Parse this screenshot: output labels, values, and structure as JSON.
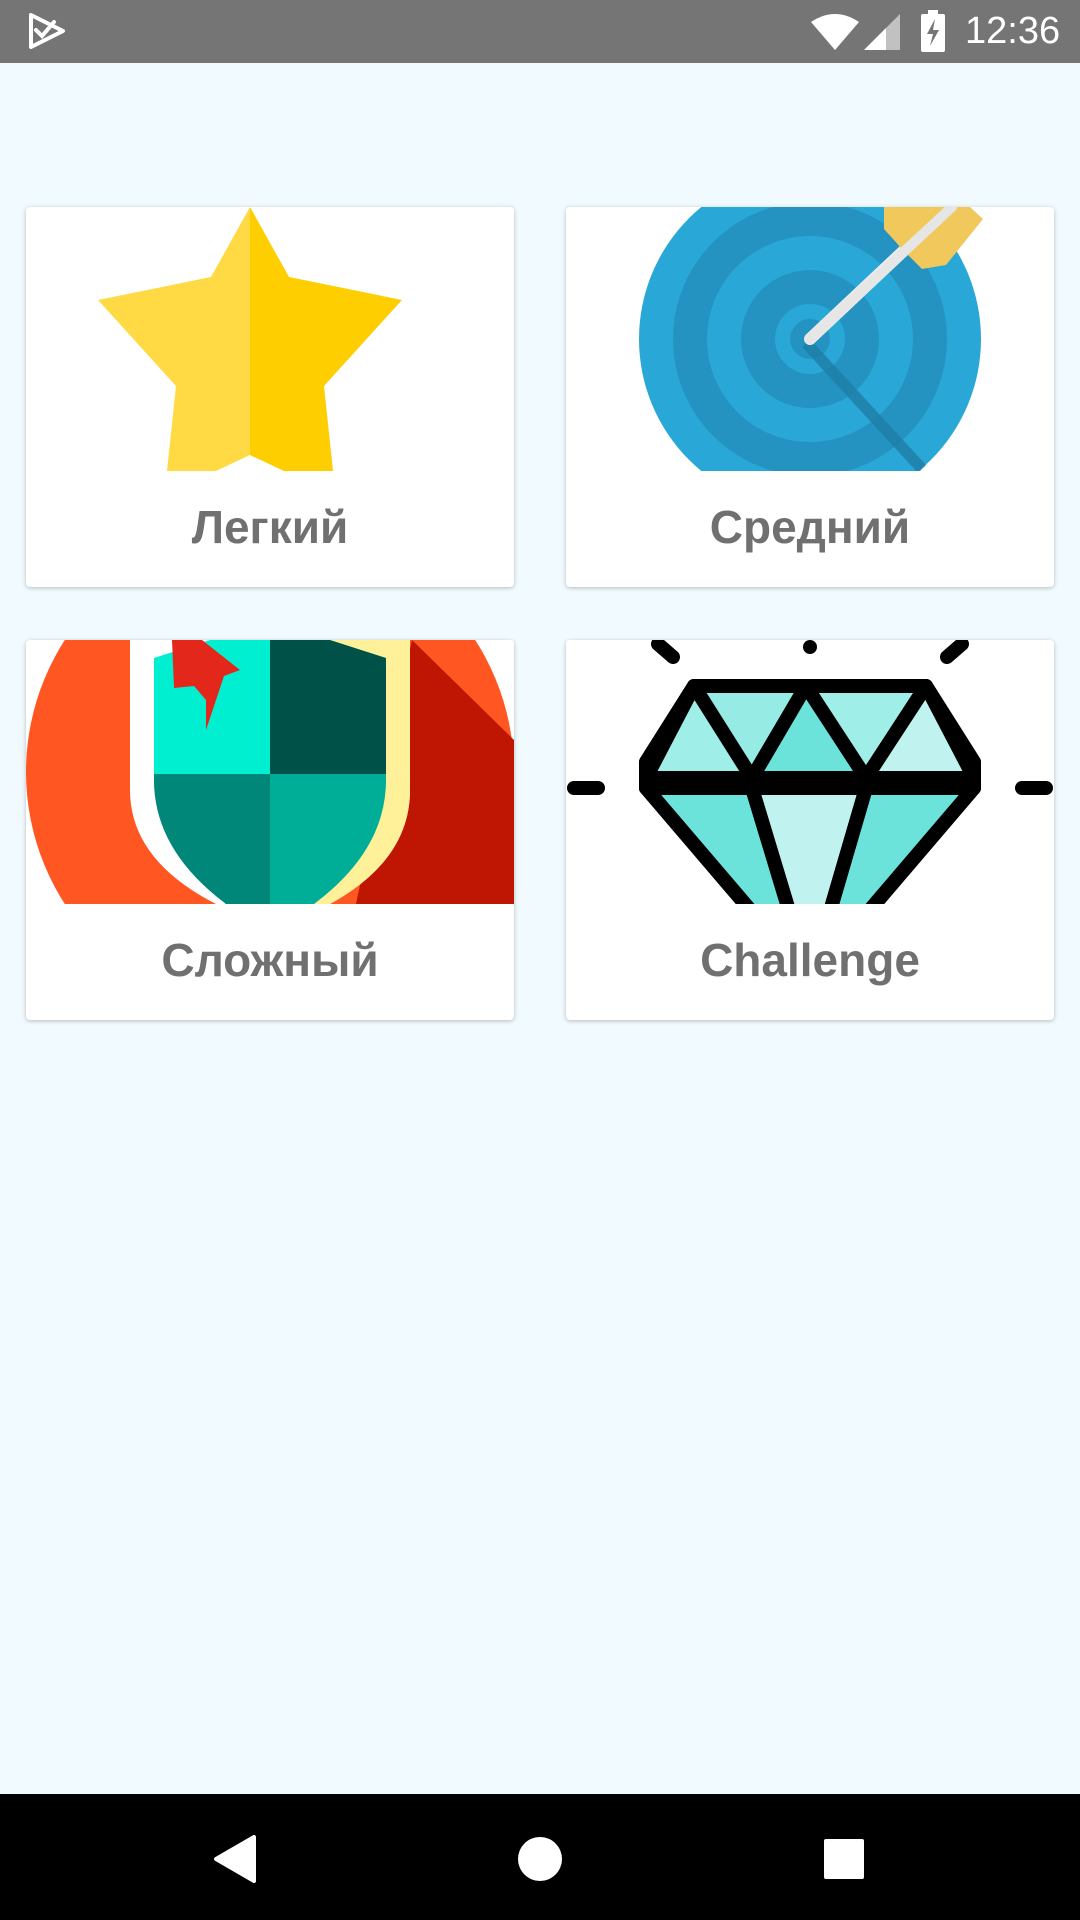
{
  "status_bar": {
    "time": "12:36",
    "icons": [
      "app-check-icon",
      "wifi-icon",
      "cell-signal-icon",
      "battery-charging-icon"
    ]
  },
  "levels": [
    {
      "label": "Легкий",
      "icon": "star-icon",
      "color": "#FFD43B"
    },
    {
      "label": "Средний",
      "icon": "target-icon",
      "color": "#26A6D5"
    },
    {
      "label": "Сложный",
      "icon": "shield-icon",
      "color": "#FF5622"
    },
    {
      "label": "Challenge",
      "icon": "diamond-icon",
      "color": "#6BE2DA"
    }
  ],
  "nav_bar": {
    "icons": [
      "back-icon",
      "home-icon",
      "recents-icon"
    ]
  }
}
